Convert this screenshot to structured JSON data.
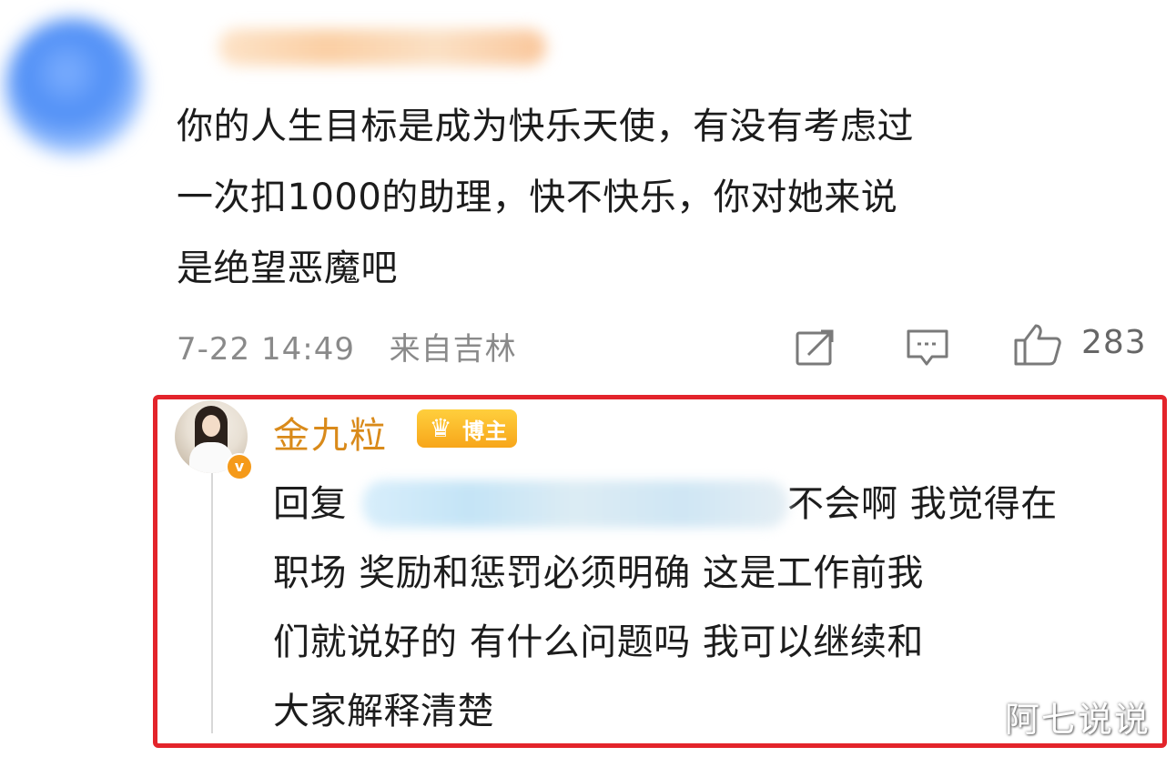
{
  "comment": {
    "text_lines": [
      "你的人生目标是成为快乐天使，有没有考虑过",
      "一次扣1000的助理，快不快乐，你对她来说",
      "是绝望恶魔吧"
    ],
    "timestamp": "7-22 14:49",
    "location": "来自吉林",
    "like_count": "283",
    "icons": [
      "share-icon",
      "comment-icon",
      "like-icon"
    ]
  },
  "reply": {
    "username": "金九粒",
    "badge_label": "博主",
    "reply_prefix": "回复",
    "text_first_line_tail": "不会啊 我觉得在",
    "text_lines": [
      "职场 奖励和惩罚必须明确 这是工作前我",
      "们就说好的 有什么问题吗 我可以继续和",
      "大家解释清楚"
    ],
    "verified_mark": "v"
  },
  "watermark": "阿七说说",
  "colors": {
    "highlight_border": "#e3242b",
    "username": "#d98a1a",
    "badge": "#f7a61a",
    "meta_text": "#8a8a8a"
  }
}
